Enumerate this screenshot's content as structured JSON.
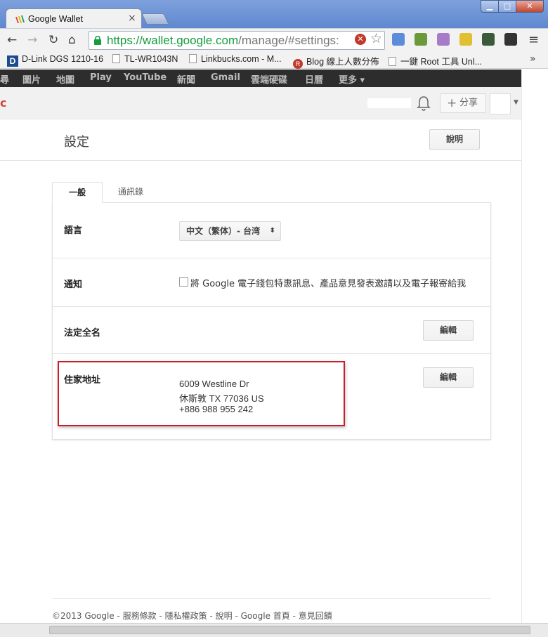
{
  "browser": {
    "tab_title": "Google Wallet",
    "tab_close": "×",
    "url_secure": "https://wallet.google.com",
    "url_path": "/manage/#settings:",
    "bookmarks": [
      {
        "label": "D-Link DGS 1210-16"
      },
      {
        "label": "TL-WR1043N"
      },
      {
        "label": "Linkbucks.com - M..."
      },
      {
        "label": "Blog 線上人數分佈"
      },
      {
        "label": "一鍵 Root 工具 Unl..."
      }
    ],
    "bookmarks_more": "»"
  },
  "gbar": {
    "items": [
      "尋",
      "圖片",
      "地圖",
      "Play",
      "YouTube",
      "新聞",
      "Gmail",
      "雲端硬碟",
      "日曆",
      "更多 ▾"
    ]
  },
  "gheader": {
    "logo_fragment": "c",
    "share_plus": "+",
    "share_label": "分享"
  },
  "page": {
    "title": "設定",
    "help_button": "說明"
  },
  "tabs": {
    "general": "一般",
    "contacts": "通訊錄"
  },
  "settings": {
    "language_label": "語言",
    "language_value": "中文（繁体）- 台湾",
    "language_arrow": "⬍",
    "notification_label": "通知",
    "notification_text": "將 Google 電子錢包特惠訊息、產品意見發表邀請以及電子報寄給我",
    "legal_name_label": "法定全名",
    "home_address_label": "住家地址",
    "edit_button": "編輯",
    "address_lines": [
      "6009 Westline Dr",
      "休斯敦 TX 77036 US",
      "+886 988 955 242"
    ]
  },
  "footer": {
    "copyright": "©2013 Google",
    "links": [
      "服務條款",
      "隱私權政策",
      "說明",
      "Google 首頁",
      "意見回饋"
    ],
    "separator": " - "
  },
  "colors": {
    "gbar_bg": "#2d2d2d",
    "highlight_border": "#c8202a",
    "url_green": "#149c3d"
  }
}
